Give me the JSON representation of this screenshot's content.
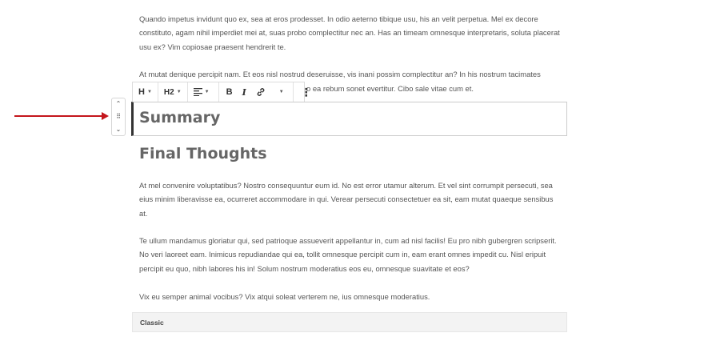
{
  "content": {
    "para1": "Quando impetus invidunt quo ex, sea at eros prodesset. In odio aeterno tibique usu, his an velit perpetua. Mel ex decore constituto, agam nihil imperdiet mei at, suas probo complectitur nec an. Has an timeam omnesque interpretaris, soluta placerat usu ex? Vim copiosae praesent hendrerit te.",
    "para2": "At mutat denique percipit nam. Et eos nisl nostrud deseruisse, vis inani possim complectitur an? In his nostrum tacimates",
    "para2_tail": "o ea rebum sonet evertitur. Cibo sale vitae cum et.",
    "heading_summary": "Summary",
    "heading_final": "Final Thoughts",
    "para3": "At mel convenire voluptatibus? Nostro consequuntur eum id. No est error utamur alterum. Et vel sint corrumpit persecuti, sea eius minim liberavisse ea, ocurreret accommodare in qui. Verear persecuti consectetuer ea sit, eam mutat quaeque sensibus at.",
    "para4": "Te ullum mandamus gloriatur qui, sed patrioque assueverit appellantur in, cum ad nisl facilis! Eu pro nibh gubergren scripserit. No veri laoreet eam. Inimicus repudiandae qui ea, tollit omnesque percipit cum in, eam erant omnes impedit cu. Nisl eripuit percipit eu quo, nibh labores his in! Solum nostrum moderatius eos eu, omnesque suavitate et eos?",
    "para5": "Vix eu semper animal vocibus? Vix atqui soleat verterem ne, ius omnesque moderatius.",
    "classic_label": "Classic"
  },
  "toolbar": {
    "block_type": "H",
    "heading_level": "H2",
    "bold": "B",
    "italic": "I",
    "more": "⋮"
  },
  "mover": {
    "up": "⌃",
    "drag": "⠿",
    "down": "⌄"
  },
  "colors": {
    "arrow": "#c4161c",
    "text": "#555555"
  }
}
